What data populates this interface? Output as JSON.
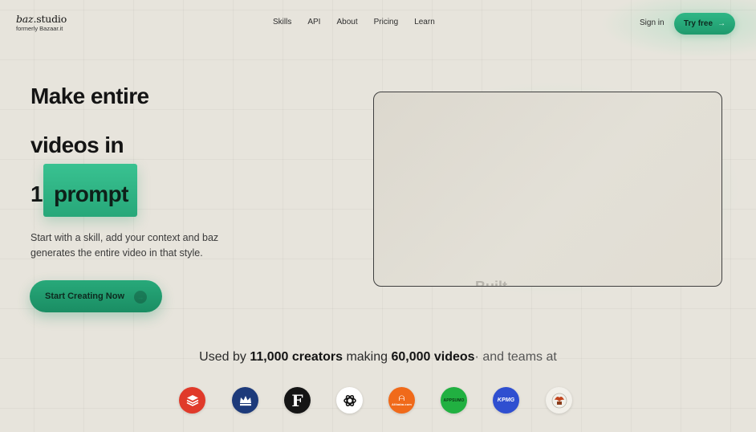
{
  "brand": {
    "name_prefix": "baz",
    "name_suffix": ".studio",
    "subtitle": "formerly Bazaar.it"
  },
  "nav": {
    "links": [
      "Skills",
      "API",
      "About",
      "Pricing",
      "Learn"
    ],
    "sign_in": "Sign in",
    "try_free": "Try free",
    "try_free_arrow": "→"
  },
  "hero": {
    "line1": "Make entire",
    "line2": "videos in",
    "number": "1",
    "highlight_word": "prompt",
    "subtext": "Start with a skill, add your context and baz generates the entire video in that style.",
    "cta_label": "Start Creating Now",
    "cta_arrow": "→",
    "accent_color": "#27a779"
  },
  "video": {
    "caption": "Built"
  },
  "stats": {
    "used_by": "Used by",
    "creators": "11,000 creators",
    "making": "making",
    "videos": "60,000 videos",
    "suffix": "· and teams at"
  },
  "logos": [
    {
      "name": "layers-stack-logo",
      "bg": "#e03a2a",
      "text": ""
    },
    {
      "name": "crown-crest-logo",
      "bg": "#1d3a7a",
      "text": ""
    },
    {
      "name": "letter-f-logo",
      "bg": "#151515",
      "text": "F"
    },
    {
      "name": "openai-logo",
      "bg": "#ffffff",
      "text": ""
    },
    {
      "name": "alibaba-logo",
      "bg": "#f06a1a",
      "text": "Alibaba.com"
    },
    {
      "name": "appsumo-logo",
      "bg": "#21b041",
      "text": "APPSUMO"
    },
    {
      "name": "kpmg-logo",
      "bg": "#2f4fd0",
      "text": "KPMG"
    },
    {
      "name": "emblem-crest-logo",
      "bg": "#f2f0ea",
      "text": ""
    }
  ]
}
